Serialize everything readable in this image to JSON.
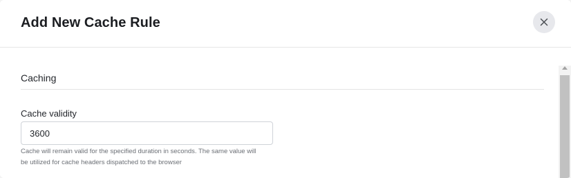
{
  "dialog": {
    "title": "Add New Cache Rule",
    "close_icon": "close-icon"
  },
  "section": {
    "title": "Caching"
  },
  "cache_validity": {
    "label": "Cache validity",
    "value": "3600",
    "help_line_1": "Cache will remain valid for the specified duration in seconds. The same value will",
    "help_line_2": "be utilized for cache headers dispatched to the browser"
  },
  "colors": {
    "close_button_bg": "#e7e8ec",
    "divider": "#e3e3e3",
    "scroll_thumb": "#c1c1c1"
  }
}
